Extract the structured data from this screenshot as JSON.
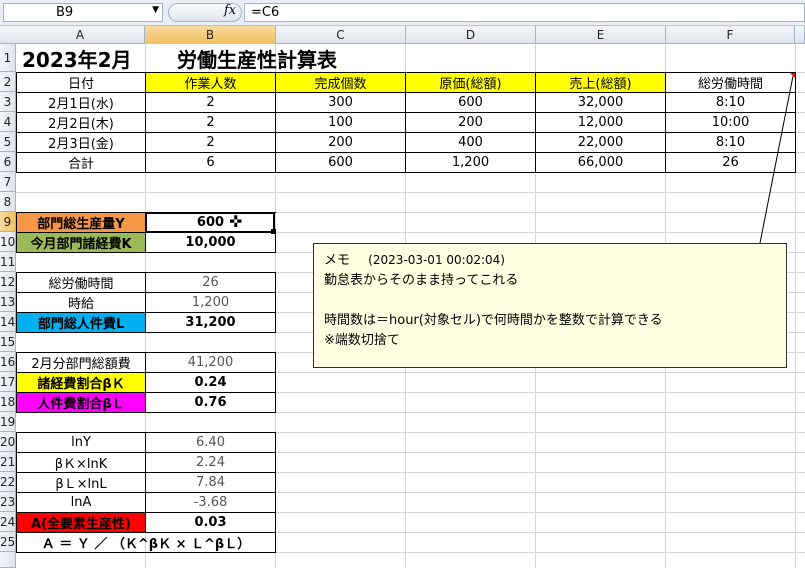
{
  "formula_bar": {
    "name_box": "B9",
    "fx": "fx",
    "formula": "=C6"
  },
  "columns": [
    "A",
    "B",
    "C",
    "D",
    "E",
    "F"
  ],
  "rows": [
    "1",
    "2",
    "3",
    "4",
    "5",
    "6",
    "7",
    "8",
    "9",
    "10",
    "11",
    "12",
    "13",
    "14",
    "15",
    "16",
    "17",
    "18",
    "19",
    "20",
    "21",
    "22",
    "23",
    "24",
    "25"
  ],
  "title": {
    "left": "2023年2月",
    "right": "労働生産性計算表"
  },
  "table": {
    "headers": [
      "日付",
      "作業人数",
      "完成個数",
      "原価(総額)",
      "売上(総額)",
      "総労働時間"
    ],
    "rows": [
      [
        "2月1日(水)",
        "2",
        "300",
        "600",
        "32,000",
        "8:10"
      ],
      [
        "2月2日(木)",
        "2",
        "100",
        "200",
        "12,000",
        "10:00"
      ],
      [
        "2月3日(金)",
        "2",
        "200",
        "400",
        "22,000",
        "8:10"
      ],
      [
        "合計",
        "6",
        "600",
        "1,200",
        "66,000",
        "26"
      ]
    ]
  },
  "calc": {
    "r9": {
      "label": "部門総生産量Y",
      "value": "600"
    },
    "r10": {
      "label": "今月部門諸経費K",
      "value": "10,000"
    },
    "r12": {
      "label": "総労働時間",
      "value": "26"
    },
    "r13": {
      "label": "時給",
      "value": "1,200"
    },
    "r14": {
      "label": "部門総人件費L",
      "value": "31,200"
    },
    "r16": {
      "label": "2月分部門総額費",
      "value": "41,200"
    },
    "r17": {
      "label": "諸経費割合βＫ",
      "value": "0.24"
    },
    "r18": {
      "label": "人件費割合βＬ",
      "value": "0.76"
    },
    "r20": {
      "label": "lnY",
      "value": "6.40"
    },
    "r21": {
      "label": "βＫ×lnK",
      "value": "2.24"
    },
    "r22": {
      "label": "βＬ×lnL",
      "value": "7.84"
    },
    "r23": {
      "label": "lnA",
      "value": "-3.68"
    },
    "r24": {
      "label": "A(全要素生産性)",
      "value": "0.03"
    },
    "r25": {
      "label": "Ａ ＝ Ｙ ／ （Ｋ^βＫ × Ｌ^βＬ）"
    }
  },
  "comment": {
    "header": "メモ",
    "date": "(2023-03-01 00:02:04)",
    "lines": [
      "勤怠表からそのまま持ってこれる",
      "",
      "時間数は＝hour(対象セル)で何時間かを整数で計算できる",
      "※端数切捨て"
    ]
  },
  "colors": {
    "yellow": "#ffff00",
    "orange": "#f79646",
    "green": "#9bbb59",
    "blue": "#00b0f0",
    "magenta": "#ff00ff",
    "red": "#ff0000",
    "comment_bg": "#ffffe1"
  }
}
